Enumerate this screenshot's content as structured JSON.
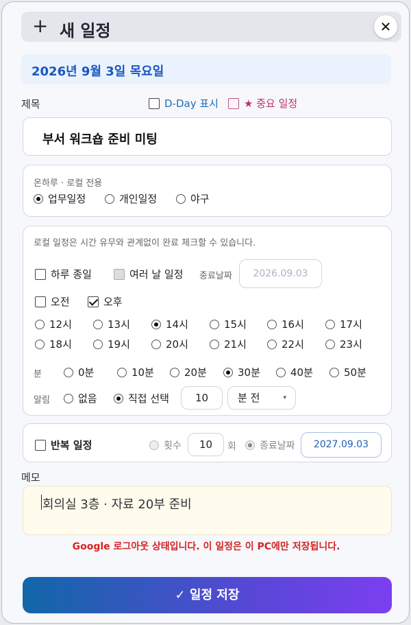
{
  "header": {
    "plus_icon": "+",
    "title": "새 일정",
    "close_icon": "✕"
  },
  "date_banner": "2026년 9월 3일 목요일",
  "title_section": {
    "label": "제목",
    "dday_label": "D-Day 표시",
    "important_star": "★",
    "important_label": "중요 일정",
    "value": "부서 워크숍 준비 미팅"
  },
  "category": {
    "note": "온하루 · 로컬 전용",
    "options": [
      "업무일정",
      "개인일정",
      "야구"
    ],
    "selected": "업무일정"
  },
  "time_section": {
    "note": "로컬 일정은 시간 유무와 관계없이 완료 체크할 수 있습니다.",
    "all_day_label": "하루 종일",
    "multi_day_label": "여러 날 일정",
    "end_date_label": "종료날짜",
    "end_date_value": "2026.09.03",
    "am_label": "오전",
    "pm_label": "오후",
    "pm_checked": true,
    "hours_row1": [
      "12시",
      "13시",
      "14시",
      "15시",
      "16시",
      "17시"
    ],
    "hours_row2": [
      "18시",
      "19시",
      "20시",
      "21시",
      "22시",
      "23시"
    ],
    "selected_hour": "14시",
    "minute_label": "분",
    "minutes": [
      "0분",
      "10분",
      "20분",
      "30분",
      "40분",
      "50분"
    ],
    "selected_minute": "30분",
    "alarm_label": "알림",
    "alarm_none": "없음",
    "alarm_custom": "직접 선택",
    "alarm_value": "10",
    "alarm_unit": "분 전",
    "alarm_chevron": "▾"
  },
  "repeat": {
    "label": "반복 일정",
    "count_label": "횟수",
    "count_value": "10",
    "count_unit": "회",
    "end_label": "종료날짜",
    "end_value": "2027.09.03"
  },
  "memo": {
    "label": "메모",
    "value": "회의실 3층 · 자료 20부 준비"
  },
  "warning": "Google 로그아웃 상태입니다. 이 일정은 이 PC에만 저장됩니다.",
  "save_button": {
    "check_icon": "✓",
    "label": "일정 저장"
  },
  "colors": {
    "accent": "#1b55c4",
    "pink": "#c0306e",
    "warning": "#d42424",
    "button_start": "#1167a8",
    "button_end": "#7b3ff0"
  }
}
